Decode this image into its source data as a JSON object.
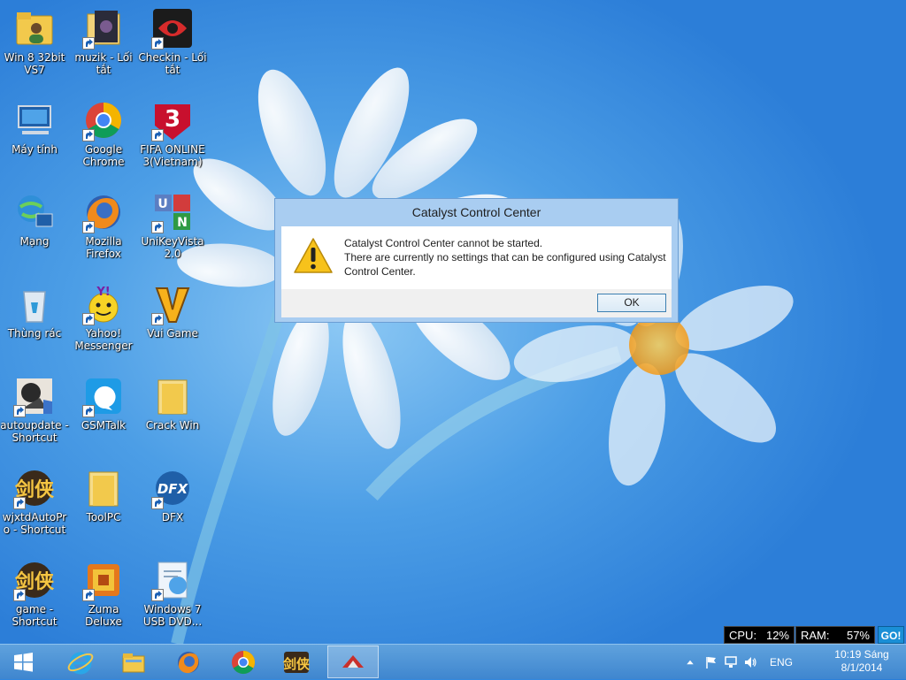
{
  "desktop": {
    "icons": [
      {
        "label": "Win 8 32bit VS7",
        "icon": "folder-user-icon",
        "shortcut": false
      },
      {
        "label": "muzik - Lối tắt",
        "icon": "folder-music-icon",
        "shortcut": true
      },
      {
        "label": "Checkin - Lối tắt",
        "icon": "checkin-app-icon",
        "shortcut": true
      },
      {
        "label": "Máy tính",
        "icon": "computer-icon",
        "shortcut": false
      },
      {
        "label": "Google Chrome",
        "icon": "chrome-icon",
        "shortcut": true
      },
      {
        "label": "FIFA ONLINE 3(Vietnam)",
        "icon": "fifa-online-icon",
        "shortcut": true
      },
      {
        "label": "Mạng",
        "icon": "network-icon",
        "shortcut": false
      },
      {
        "label": "Mozilla Firefox",
        "icon": "firefox-icon",
        "shortcut": true
      },
      {
        "label": "UniKeyVista 2.0",
        "icon": "unikey-icon",
        "shortcut": true
      },
      {
        "label": "Thùng rác",
        "icon": "recycle-bin-icon",
        "shortcut": false
      },
      {
        "label": "Yahoo! Messenger",
        "icon": "yahoo-messenger-icon",
        "shortcut": true
      },
      {
        "label": "Vui Game",
        "icon": "vui-game-icon",
        "shortcut": true
      },
      {
        "label": "autoupdate - Shortcut",
        "icon": "autoupdate-icon",
        "shortcut": true
      },
      {
        "label": "GSMTalk",
        "icon": "gsmtalk-icon",
        "shortcut": true
      },
      {
        "label": "Crack Win",
        "icon": "folder-icon",
        "shortcut": false
      },
      {
        "label": "wjxtdAutoPro - Shortcut",
        "icon": "jianxia-game-icon",
        "shortcut": true
      },
      {
        "label": "ToolPC",
        "icon": "folder-icon",
        "shortcut": false
      },
      {
        "label": "DFX",
        "icon": "dfx-icon",
        "shortcut": true
      },
      {
        "label": "game - Shortcut",
        "icon": "jianxia-game-icon",
        "shortcut": true
      },
      {
        "label": "Zuma Deluxe",
        "icon": "zuma-icon",
        "shortcut": true
      },
      {
        "label": "Windows 7 USB DVD...",
        "icon": "usb-dvd-tool-icon",
        "shortcut": true
      }
    ]
  },
  "dialog": {
    "title": "Catalyst Control Center",
    "line1": "Catalyst Control Center cannot be started.",
    "line2": "There are currently no settings that can be configured using Catalyst Control Center.",
    "ok_label": "OK",
    "icon": "warning-icon"
  },
  "meter": {
    "cpu_label": "CPU:",
    "cpu_value": "12%",
    "ram_label": "RAM:",
    "ram_value": "57%",
    "go_label": "GO!"
  },
  "taskbar": {
    "apps": [
      "start-button",
      "internet-explorer-icon",
      "file-explorer-icon",
      "firefox-icon",
      "chrome-icon",
      "jianxia-game-icon",
      "catalyst-icon"
    ],
    "active_app": "catalyst-icon",
    "language": "ENG",
    "time": "10:19 Sáng",
    "date": "8/1/2014"
  },
  "colors": {
    "wallpaper": "#3f95e3",
    "taskbar": "#4a8fd4",
    "dialog_frame": "#a9cdf1",
    "meter_bg": "#000000",
    "go_bg": "#1a8fd6"
  }
}
